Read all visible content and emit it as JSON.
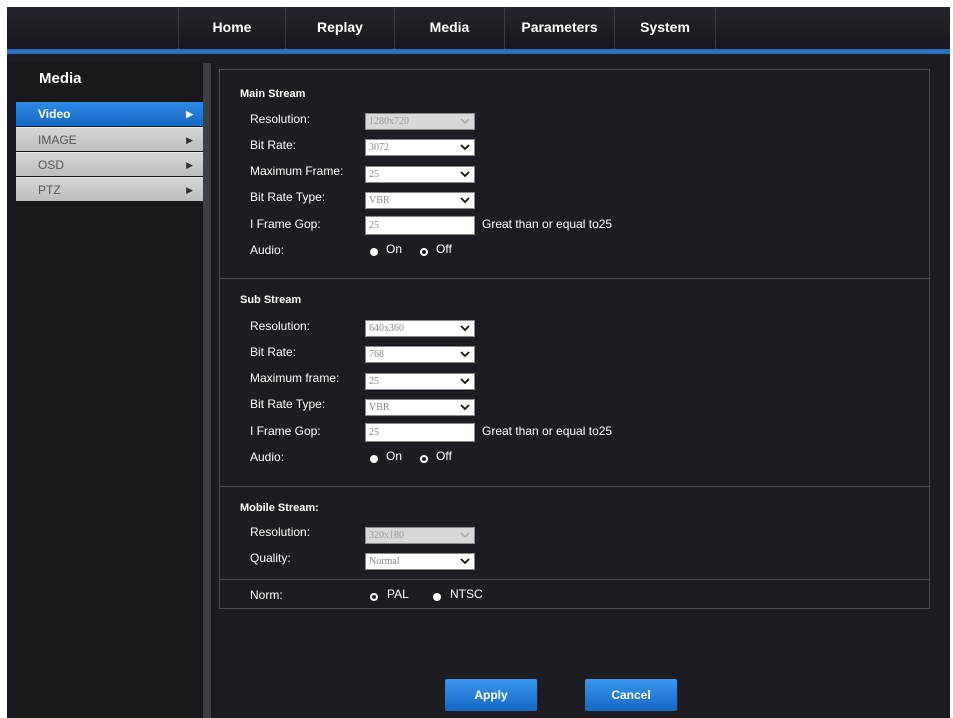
{
  "nav": {
    "items": [
      "Home",
      "Replay",
      "Media",
      "Parameters",
      "System"
    ]
  },
  "sidebar": {
    "title": "Media",
    "items": [
      {
        "label": "Video",
        "active": true
      },
      {
        "label": "IMAGE",
        "active": false
      },
      {
        "label": "OSD",
        "active": false
      },
      {
        "label": "PTZ",
        "active": false
      }
    ]
  },
  "main_stream": {
    "title": "Main Stream",
    "resolution_label": "Resolution:",
    "resolution_value": "1280x720",
    "bit_rate_label": "Bit Rate:",
    "bit_rate_value": "3072",
    "max_frame_label": "Maximum Frame:",
    "max_frame_value": "25",
    "bit_rate_type_label": "Bit Rate Type:",
    "bit_rate_type_value": "VBR",
    "iframe_gop_label": "I Frame Gop:",
    "iframe_gop_value": "25",
    "iframe_gop_hint": "Great than or equal to25",
    "audio_label": "Audio:",
    "audio_on": "On",
    "audio_off": "Off",
    "audio_selected": "On"
  },
  "sub_stream": {
    "title": "Sub Stream",
    "resolution_label": "Resolution:",
    "resolution_value": "640x360",
    "bit_rate_label": "Bit Rate:",
    "bit_rate_value": "768",
    "max_frame_label": "Maximum frame:",
    "max_frame_value": "25",
    "bit_rate_type_label": "Bit Rate Type:",
    "bit_rate_type_value": "VBR",
    "iframe_gop_label": "I Frame Gop:",
    "iframe_gop_value": "25",
    "iframe_gop_hint": "Great than or equal to25",
    "audio_label": "Audio:",
    "audio_on": "On",
    "audio_off": "Off",
    "audio_selected": "On"
  },
  "mobile_stream": {
    "title": "Mobile Stream:",
    "resolution_label": "Resolution:",
    "resolution_value": "320x180",
    "quality_label": "Quality:",
    "quality_value": "Normal"
  },
  "norm": {
    "label": "Norm:",
    "pal": "PAL",
    "ntsc": "NTSC",
    "selected": "NTSC"
  },
  "buttons": {
    "apply": "Apply",
    "cancel": "Cancel"
  },
  "colors": {
    "accent": "#2d6fbf",
    "background": "#1b1d22",
    "button": "#1e7ad8"
  }
}
